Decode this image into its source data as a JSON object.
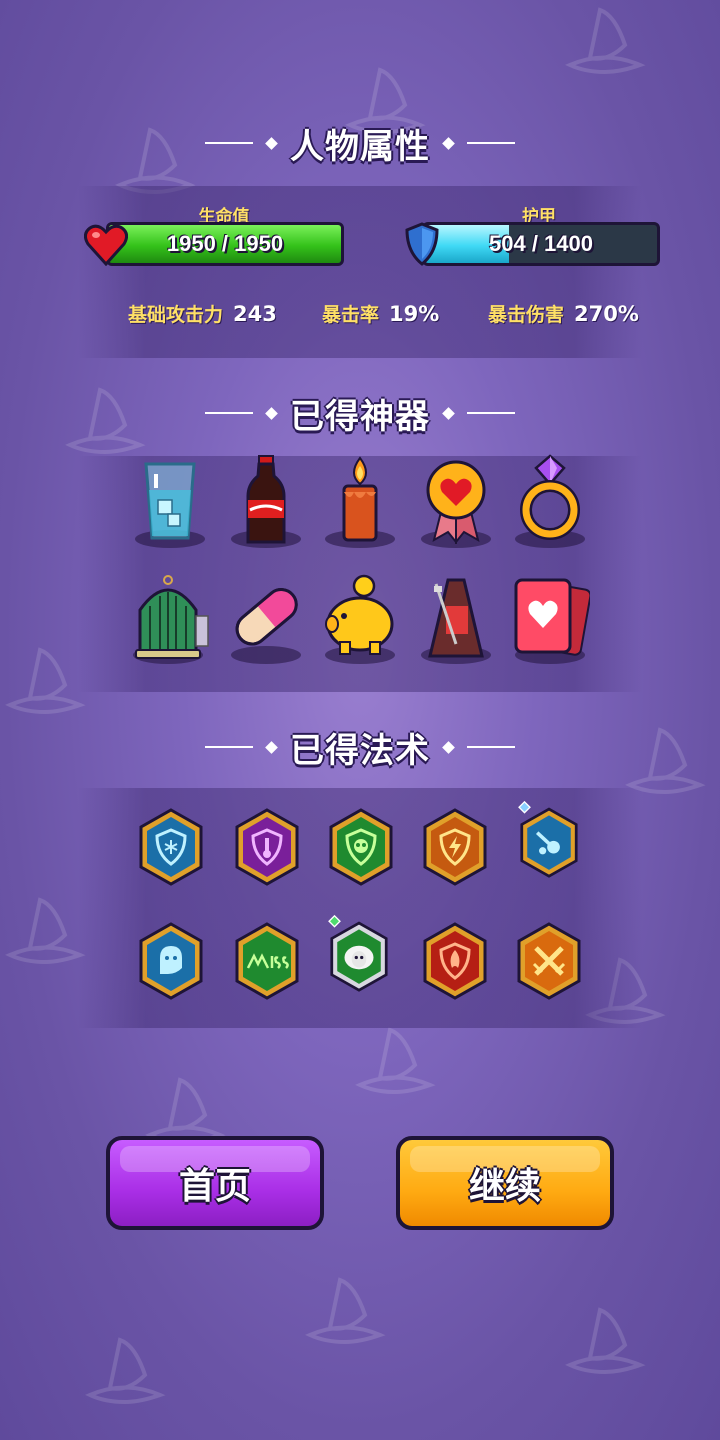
{
  "sections": {
    "attributes_title": "人物属性",
    "artifacts_title": "已得神器",
    "spells_title": "已得法术"
  },
  "hp": {
    "label": "生命值",
    "text": "1950 / 1950",
    "fraction": 1.0,
    "color": "#34c21a",
    "icon": "heart-icon"
  },
  "armor": {
    "label": "护甲",
    "text": "504 / 1400",
    "fraction": 0.36,
    "color": "#3fd9f5",
    "icon": "shield-icon"
  },
  "stats": [
    {
      "label": "基础攻击力",
      "value": "243"
    },
    {
      "label": "暴击率",
      "value": "19%"
    },
    {
      "label": "暴击伤害",
      "value": "270%"
    }
  ],
  "artifacts": [
    "ice-water-glass-icon",
    "cola-bottle-icon",
    "candle-icon",
    "heart-medal-icon",
    "gem-ring-icon",
    "birdcage-icon",
    "pill-capsule-icon",
    "piggy-bank-icon",
    "metronome-icon",
    "heart-playing-card-icon"
  ],
  "spells": [
    "frost-shield-icon",
    "thermometer-shield-icon",
    "skull-shield-icon",
    "lightning-shield-icon",
    "meteor-icon",
    "ghost-icon",
    "miss-icon",
    "sheep-icon",
    "fire-shield-icon",
    "crossed-swords-icon"
  ],
  "buttons": {
    "home": "首页",
    "continue": "继续"
  },
  "colors": {
    "home_button": "#b23ff0",
    "continue_button": "#ffad13",
    "background": "#7e66bd"
  }
}
